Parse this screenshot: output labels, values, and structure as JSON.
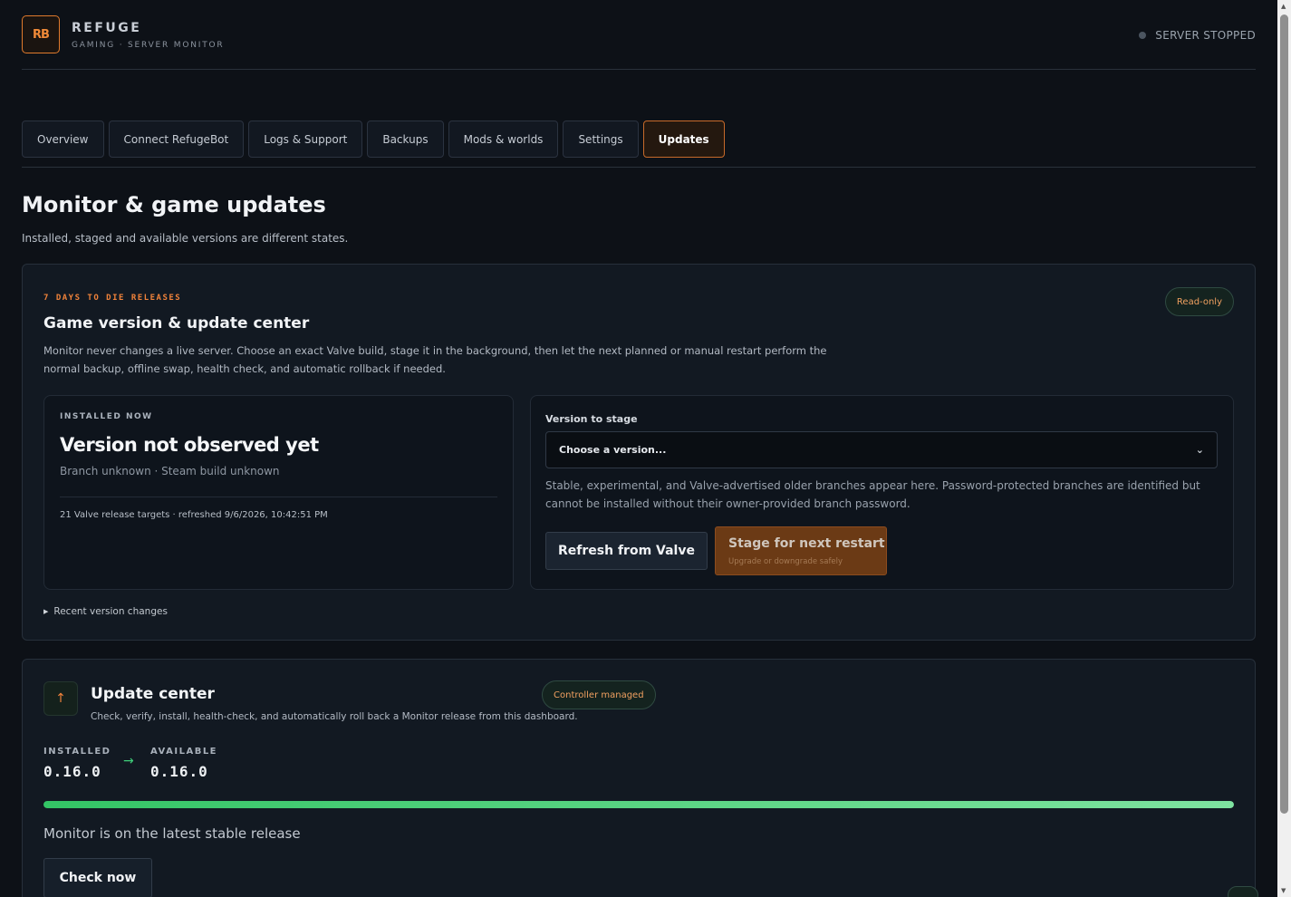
{
  "header": {
    "logo_text": "RB",
    "title": "REFUGE",
    "subtitle": "GAMING · SERVER MONITOR",
    "status": "SERVER STOPPED"
  },
  "tabs": [
    {
      "label": "Overview"
    },
    {
      "label": "Connect RefugeBot"
    },
    {
      "label": "Logs & Support"
    },
    {
      "label": "Backups"
    },
    {
      "label": "Mods & worlds"
    },
    {
      "label": "Settings"
    },
    {
      "label": "Updates",
      "active": true
    }
  ],
  "page": {
    "title": "Monitor & game updates",
    "subtitle": "Installed, staged and available versions are different states."
  },
  "game_card": {
    "eyebrow": "7 DAYS TO DIE RELEASES",
    "title": "Game version & update center",
    "badge": "Read-only",
    "description": "Monitor never changes a live server. Choose an exact Valve build, stage it in the background, then let the next planned or manual restart perform the normal backup, offline swap, health check, and automatic rollback if needed.",
    "installed": {
      "label": "INSTALLED NOW",
      "title": "Version not observed yet",
      "subtitle": "Branch unknown · Steam build unknown",
      "meta": "21 Valve release targets · refreshed 9/6/2026, 10:42:51 PM"
    },
    "stage": {
      "label": "Version to stage",
      "select_value": "Choose a version...",
      "help": "Stable, experimental, and Valve-advertised older branches appear here. Password-protected branches are identified but cannot be installed without their owner-provided branch password.",
      "refresh_label": "Refresh from Valve",
      "stage_label": "Stage for next restart",
      "stage_hint": "Upgrade or downgrade safely"
    },
    "recent_label": "Recent version changes"
  },
  "update_card": {
    "icon": "arrow-up-icon",
    "icon_glyph": "↑",
    "title": "Update center",
    "description": "Check, verify, install, health-check, and automatically roll back a Monitor release from this dashboard.",
    "badge": "Controller managed",
    "installed_label": "INSTALLED",
    "installed_version": "0.16.0",
    "arrow": "→",
    "available_label": "AVAILABLE",
    "available_version": "0.16.0",
    "progress": 1.0,
    "status": "Monitor is on the latest stable release",
    "check_label": "Check now"
  },
  "colors": {
    "accent": "#f0823a",
    "success": "#33c465",
    "background": "#0d1117"
  }
}
